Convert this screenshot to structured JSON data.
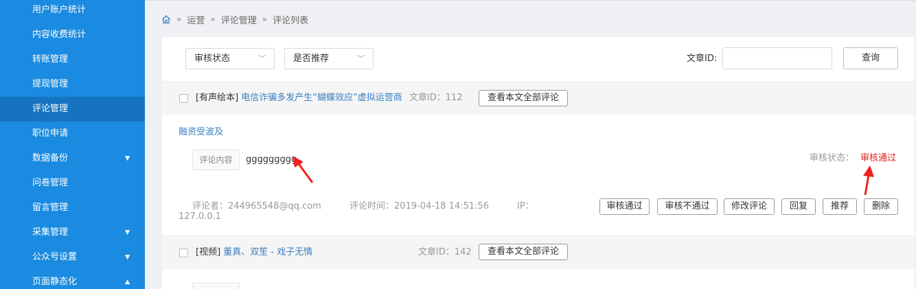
{
  "sidebar": {
    "items": [
      {
        "label": "用户账户统计"
      },
      {
        "label": "内容收费统计"
      },
      {
        "label": "转账管理"
      },
      {
        "label": "提现管理"
      },
      {
        "label": "评论管理"
      },
      {
        "label": "职位申请"
      },
      {
        "label": "数据备份",
        "arrow": "▼"
      },
      {
        "label": "问卷管理"
      },
      {
        "label": "留言管理"
      },
      {
        "label": "采集管理",
        "arrow": "▼"
      },
      {
        "label": "公众号设置",
        "arrow": "▼"
      },
      {
        "label": "页面静态化",
        "arrow": "▲"
      }
    ]
  },
  "breadcrumb": {
    "home_icon": "home-icon",
    "sep": "»",
    "items": [
      "运营",
      "评论管理",
      "评论列表"
    ]
  },
  "filters": {
    "audit_status": "审核状态",
    "recommend": "是否推荐",
    "caret": "﹀",
    "article_id_label": "文章ID:",
    "article_id_value": "",
    "query_button": "查询"
  },
  "comments": [
    {
      "tag": "[有声绘本]",
      "title": "电信诈骗多发产生“蝴蝶效应”虚拟运营商",
      "article_id": "文章ID：112",
      "view_all": "查看本文全部评论",
      "subtitle": "融资受波及",
      "content_label": "评论内容",
      "content": "ggggggggg",
      "status_label": "审核状态：",
      "status_value": "审核通过",
      "commenter": "评论者：244965548@qq.com",
      "time": "评论时间：2019-04-18 14:51:56",
      "ip_label": "IP：",
      "ip_value": "127.0.0.1",
      "actions": [
        "审核通过",
        "审核不通过",
        "修改评论",
        "回复",
        "推荐",
        "删除"
      ]
    },
    {
      "tag": "[视频]",
      "title": "董真、双笙 - 戏子无情",
      "article_id": "文章ID：142",
      "view_all": "查看本文全部评论"
    }
  ],
  "colors": {
    "sidebar_bg": "#1a8be0",
    "sidebar_active": "#1573c0",
    "link": "#3a7fc2",
    "status_ok": "#e02020",
    "annotation_arrow": "#f02020"
  }
}
